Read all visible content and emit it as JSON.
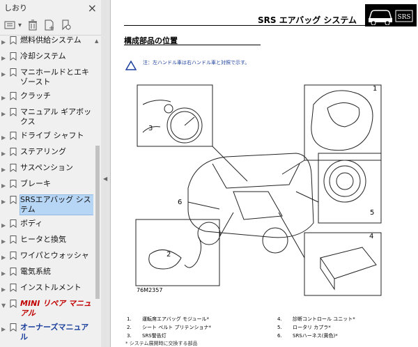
{
  "sidebar": {
    "title": "しおり",
    "close": "×",
    "items": [
      {
        "label": "燃料供給システム",
        "arrow": "▶",
        "cls": ""
      },
      {
        "label": "冷却システム",
        "arrow": "▶",
        "cls": ""
      },
      {
        "label": "マニホールドとエキゾースト",
        "arrow": "▶",
        "cls": ""
      },
      {
        "label": "クラッチ",
        "arrow": "▶",
        "cls": ""
      },
      {
        "label": "マニュアル ギアボックス",
        "arrow": "▶",
        "cls": ""
      },
      {
        "label": "ドライブ シャフト",
        "arrow": "▶",
        "cls": ""
      },
      {
        "label": "ステアリング",
        "arrow": "▶",
        "cls": ""
      },
      {
        "label": "サスペンション",
        "arrow": "▶",
        "cls": ""
      },
      {
        "label": "ブレーキ",
        "arrow": "▶",
        "cls": ""
      },
      {
        "label": "SRSエアバッグ システム",
        "arrow": "▶",
        "cls": "sel"
      },
      {
        "label": "ボディ",
        "arrow": "▶",
        "cls": ""
      },
      {
        "label": "ヒータと換気",
        "arrow": "▶",
        "cls": ""
      },
      {
        "label": "ワイパとウォッシャ",
        "arrow": "▶",
        "cls": ""
      },
      {
        "label": "電気系統",
        "arrow": "▶",
        "cls": ""
      },
      {
        "label": "インストルメント",
        "arrow": "▶",
        "cls": ""
      },
      {
        "label": "MINI リペア マニュアル",
        "arrow": "▼",
        "cls": "red"
      },
      {
        "label": "オーナーズマニュアル",
        "arrow": "▶",
        "cls": "blue"
      }
    ]
  },
  "doc": {
    "header_title": "SRS エアバッグ システム",
    "logo_text": "SRS",
    "section_title": "構成部品の位置",
    "note": "注：左ハンドル車は右ハンドル車と対照で示す。",
    "figure_id": "76M2357",
    "callouts": [
      "1",
      "2",
      "3",
      "4",
      "5",
      "6"
    ],
    "legend_left": [
      {
        "n": "1.",
        "t": "運転席エアバッグ モジュール*"
      },
      {
        "n": "2.",
        "t": "シート ベルト プリテンショナ*"
      },
      {
        "n": "3.",
        "t": "SRS警告灯"
      }
    ],
    "legend_right": [
      {
        "n": "4.",
        "t": "診断コントロール ユニット*"
      },
      {
        "n": "5.",
        "t": "ロータリ カプラ*"
      },
      {
        "n": "6.",
        "t": "SRSハーネス(黄色)*"
      }
    ],
    "footnote": "* システム展開時に交換する部品"
  },
  "colors": {
    "selection": "#b7d6f5",
    "note_blue": "#1a3e9c",
    "mini_red": "#c00000"
  }
}
